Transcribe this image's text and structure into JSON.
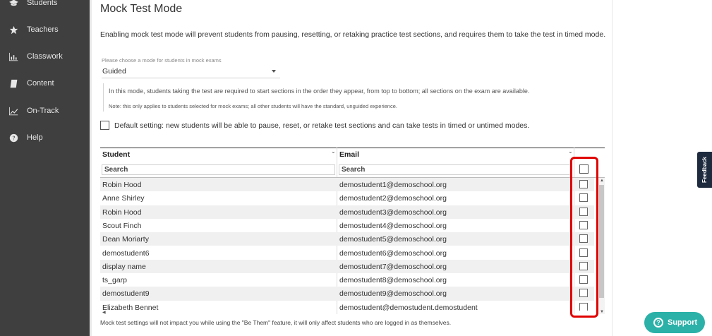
{
  "sidebar": {
    "items": [
      {
        "label": "Students",
        "icon": "graduation-cap-icon"
      },
      {
        "label": "Teachers",
        "icon": "star-icon"
      },
      {
        "label": "Classwork",
        "icon": "bar-chart-icon"
      },
      {
        "label": "Content",
        "icon": "book-icon"
      },
      {
        "label": "On-Track",
        "icon": "line-chart-icon"
      },
      {
        "label": "Help",
        "icon": "question-circle-icon"
      }
    ]
  },
  "page": {
    "title": "Mock Test Mode",
    "description": "Enabling mock test mode will prevent students from pausing, resetting, or retaking practice test sections, and requires them to take the test in timed mode.",
    "mode_select": {
      "label": "Please choose a mode for students in mock exams",
      "value": "Guided"
    },
    "info": {
      "line1": "In this mode, students taking the test are required to start sections in the order they appear, from top to bottom; all sections on the exam are available.",
      "line2": "Note: this only applies to students selected for mock exams; all other students will have the standard, unguided experience."
    },
    "default_setting": "Default setting: new students will be able to pause, reset, or retake test sections and can take tests in timed or untimed modes.",
    "footer": "Mock test settings will not impact you while using the \"Be Them\" feature, it will only affect students who are logged in as themselves."
  },
  "table": {
    "columns": [
      "Student",
      "Email"
    ],
    "filter_placeholders": [
      "Search",
      "Search"
    ],
    "rows": [
      {
        "student": "Robin Hood",
        "email": "demostudent1@demoschool.org",
        "checked": false
      },
      {
        "student": "Anne Shirley",
        "email": "demostudent2@demoschool.org",
        "checked": false
      },
      {
        "student": "Robin Hood",
        "email": "demostudent3@demoschool.org",
        "checked": false
      },
      {
        "student": "Scout Finch",
        "email": "demostudent4@demoschool.org",
        "checked": false
      },
      {
        "student": "Dean Moriarty",
        "email": "demostudent5@demoschool.org",
        "checked": false
      },
      {
        "student": "demostudent6",
        "email": "demostudent6@demoschool.org",
        "checked": false
      },
      {
        "student": "display name",
        "email": "demostudent7@demoschool.org",
        "checked": false
      },
      {
        "student": "ts_garp",
        "email": "demostudent8@demoschool.org",
        "checked": false
      },
      {
        "student": "demostudent9",
        "email": "demostudent9@demoschool.org",
        "checked": false
      },
      {
        "student": "Elizabeth Bennet",
        "email": "demostudent@demostudent.demostudent",
        "checked": false
      }
    ]
  },
  "widgets": {
    "feedback": "Feedback",
    "support": "Support"
  },
  "colors": {
    "sidebar_bg": "#3f3f3f",
    "highlight": "#e00000",
    "support_bg": "#2bb1a8",
    "feedback_bg": "#1e2b3f"
  }
}
